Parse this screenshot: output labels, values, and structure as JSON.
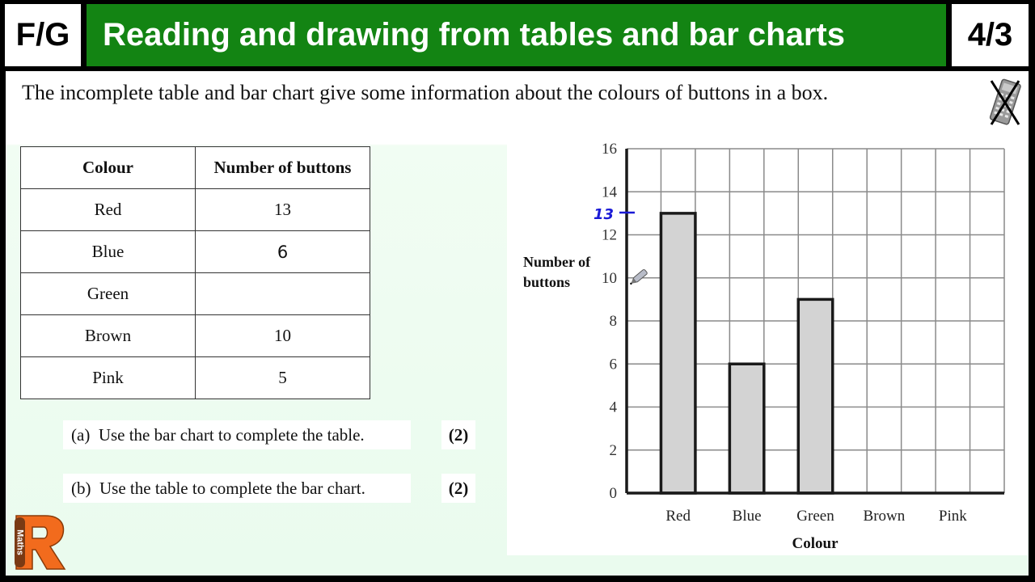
{
  "header": {
    "level": "F/G",
    "title": "Reading and drawing from tables and bar charts",
    "page": "4/3"
  },
  "question": {
    "intro": "The incomplete table and bar chart give some information about the colours of buttons in a box.",
    "calculator_icon": "no-calculator-icon",
    "parts": [
      {
        "label": "(a)",
        "text": "Use the bar chart to complete the table.",
        "marks": "(2)"
      },
      {
        "label": "(b)",
        "text": "Use the table to complete the bar chart.",
        "marks": "(2)"
      }
    ]
  },
  "table": {
    "headers": [
      "Colour",
      "Number of buttons"
    ],
    "rows": [
      {
        "colour": "Red",
        "count": "13",
        "handwritten": false
      },
      {
        "colour": "Blue",
        "count": "6",
        "handwritten": true
      },
      {
        "colour": "Green",
        "count": "",
        "handwritten": false
      },
      {
        "colour": "Brown",
        "count": "10",
        "handwritten": false
      },
      {
        "colour": "Pink",
        "count": "5",
        "handwritten": false
      }
    ]
  },
  "annotations": {
    "handwritten_axis_mark": "13",
    "handwritten_color": "#1a1ad6",
    "cursor_icon": "pen-cursor-icon"
  },
  "logo": {
    "letter": "R",
    "text": "Maths",
    "color": "#f26b1d"
  },
  "colors": {
    "header_green": "#138413",
    "bar_fill": "#d3d3d3"
  },
  "chart_data": {
    "type": "bar",
    "title": "",
    "xlabel": "Colour",
    "ylabel": "Number of buttons",
    "categories": [
      "Red",
      "Blue",
      "Green",
      "Brown",
      "Pink"
    ],
    "values": [
      13,
      6,
      9,
      null,
      null
    ],
    "ylim": [
      0,
      16
    ],
    "yticks": [
      0,
      2,
      4,
      6,
      8,
      10,
      12,
      14,
      16
    ],
    "grid": true,
    "legend": "none"
  }
}
